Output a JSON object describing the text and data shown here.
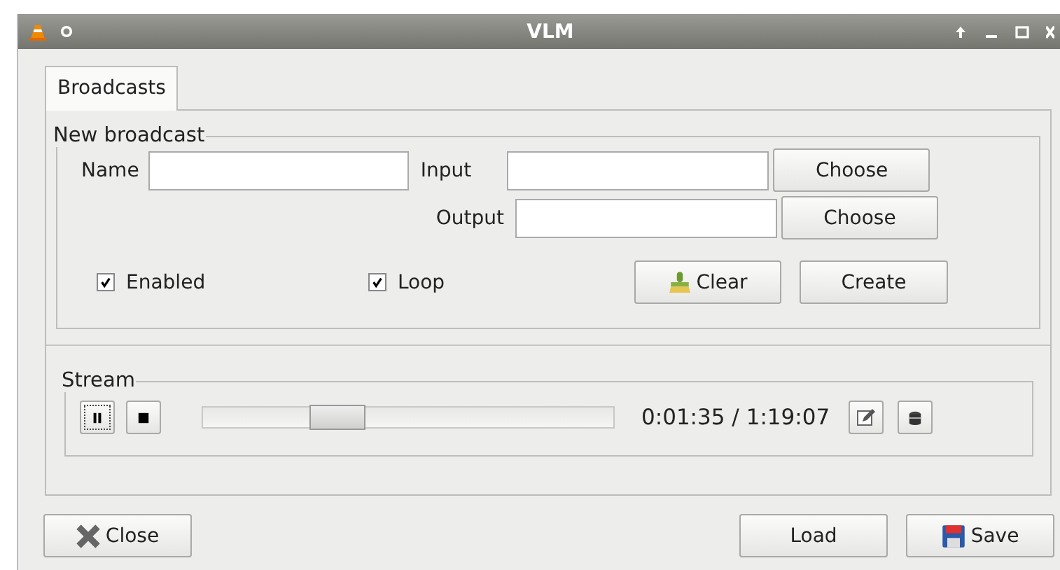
{
  "window": {
    "title": "VLM"
  },
  "tabs": [
    {
      "label": "Broadcasts",
      "selected": true
    }
  ],
  "new_broadcast": {
    "title": "New broadcast",
    "name_label": "Name",
    "input_label": "Input",
    "output_label": "Output",
    "choose_buttons": [
      "Choose",
      "Choose"
    ],
    "checkboxes": [
      {
        "label": "Enabled",
        "checked": true
      },
      {
        "label": "Loop",
        "checked": true
      }
    ],
    "clear_button": "Clear",
    "create_button": "Create"
  },
  "stream": {
    "title": "Stream",
    "slider": {
      "level": 0.3
    },
    "time": "0:01:35 / 1:19:07"
  },
  "buttons": {
    "close": "Close",
    "load": "Load",
    "save": "Save"
  }
}
